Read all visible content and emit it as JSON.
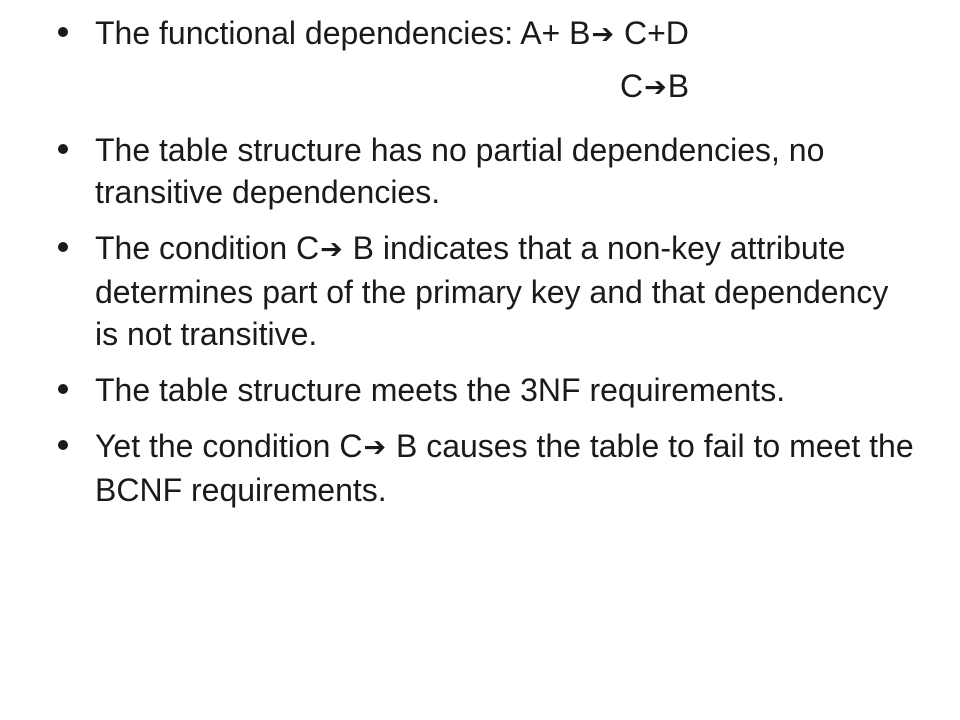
{
  "arrow_glyph": "➔",
  "bullets": [
    {
      "pre": "The functional dependencies:  A+ B",
      "post": " C+D"
    },
    {
      "pre": "The table structure has no partial dependencies, no transitive dependencies."
    },
    {
      "pre": "The condition C",
      "post": " B indicates that a non-key attribute determines part of the primary key and that dependency is not transitive."
    },
    {
      "pre": "The table structure meets the 3NF requirements."
    },
    {
      "pre": "Yet the condition C",
      "post": " B causes the table to fail to meet the BCNF requirements."
    }
  ],
  "continuation": {
    "pre": "C",
    "post": "B"
  }
}
